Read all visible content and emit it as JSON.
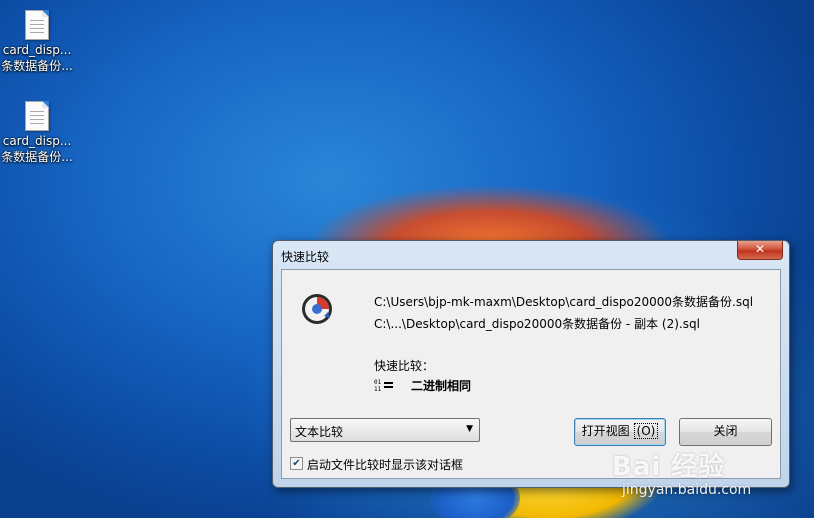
{
  "desktop": {
    "icons": [
      {
        "name_line1": "card_disp...",
        "name_line2": "条数据备份..."
      },
      {
        "name_line1": "card_disp...",
        "name_line2": "条数据备份..."
      }
    ]
  },
  "dialog": {
    "title": "快速比较",
    "close_glyph": "✕",
    "file1": "C:\\Users\\bjp-mk-maxm\\Desktop\\card_dispo20000条数据备份.sql",
    "file2": "C:\\...\\Desktop\\card_dispo20000条数据备份 - 副本 (2).sql",
    "quick_compare_label": "快速比较：",
    "result_text": "二进制相同",
    "compare_type_selected": "文本比较",
    "open_view_button": "打开视图",
    "open_view_hotkey": "(O)",
    "close_button": "关闭",
    "show_dialog_checkbox_label": "启动文件比较时显示该对话框",
    "show_dialog_checked": true
  },
  "watermark": {
    "logo_text": "Bai 经验",
    "url": "jingyan.baidu.com"
  }
}
